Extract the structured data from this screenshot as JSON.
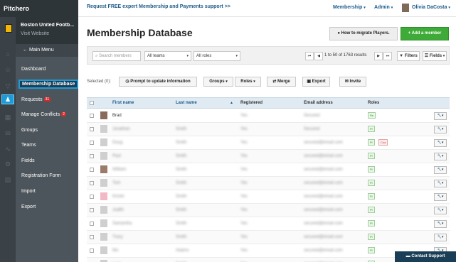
{
  "brand": "Pitchero",
  "club": {
    "name": "Boston United Footb...",
    "visit_label": "Visit Website"
  },
  "nav": {
    "main_menu": "Main Menu",
    "items": [
      {
        "label": "Dashboard"
      },
      {
        "label": "Membership Database",
        "selected": true
      },
      {
        "label": "Requests",
        "badge": "31"
      },
      {
        "label": "Manage Conflicts",
        "badge": "2"
      },
      {
        "label": "Groups"
      },
      {
        "label": "Teams"
      },
      {
        "label": "Fields"
      },
      {
        "label": "Registration Form"
      },
      {
        "label": "Import"
      },
      {
        "label": "Export"
      }
    ]
  },
  "topbar": {
    "promo": "Request FREE expert Membership and Payments support >>",
    "membership": "Membership",
    "admin": "Admin",
    "user": "Olivia DaCosta"
  },
  "page": {
    "title": "Membership Database",
    "migrate_button": "How to migrate Players.",
    "add_member_button": "+ Add a member"
  },
  "filters": {
    "search_placeholder": "Search members",
    "teams": "All teams",
    "roles": "All roles",
    "results": "1 to 50 of 1763 results",
    "filters_button": "Filters",
    "fields_button": "Fields"
  },
  "actions": {
    "selected": "Selected (0):",
    "prompt": "Prompt to update information",
    "groups": "Groups",
    "roles": "Roles",
    "merge": "Merge",
    "export": "Export",
    "invite": "Invite"
  },
  "table": {
    "columns": [
      "First name",
      "Last name",
      "Registered",
      "Email address",
      "Roles"
    ],
    "rows": [
      {
        "first": "Brad",
        "last": "",
        "registered": "Yes",
        "email": "Secured",
        "roles": [
          "Re"
        ],
        "thumb": "#8a6a5a"
      },
      {
        "first": "Jonathan",
        "last": "Smith",
        "registered": "Yes",
        "email": "Secured",
        "roles": [
          "Pl"
        ],
        "thumb": "#cfcfcf"
      },
      {
        "first": "Doug",
        "last": "Smith",
        "registered": "Yes",
        "email": "secured@email.com",
        "roles": [
          "Pl",
          "Coa"
        ],
        "thumb": "#cfcfcf"
      },
      {
        "first": "Paul",
        "last": "Smith",
        "registered": "Yes",
        "email": "secured@email.com",
        "roles": [
          "Pl"
        ],
        "thumb": "#cfcfcf"
      },
      {
        "first": "William",
        "last": "Smith",
        "registered": "Yes",
        "email": "secured@email.com",
        "roles": [
          "Pl"
        ],
        "thumb": "#9a7a68"
      },
      {
        "first": "Tom",
        "last": "Smith",
        "registered": "Yes",
        "email": "secured@email.com",
        "roles": [
          "Pl"
        ],
        "thumb": "#cfcfcf"
      },
      {
        "first": "Kristin",
        "last": "Smith",
        "registered": "Yes",
        "email": "secured@email.com",
        "roles": [
          "Pl"
        ],
        "thumb": "#f2b8c6"
      },
      {
        "first": "Judith",
        "last": "Smith",
        "registered": "Yes",
        "email": "secured@email.com",
        "roles": [
          "Pl"
        ],
        "thumb": "#cfcfcf"
      },
      {
        "first": "Samantha",
        "last": "Smith",
        "registered": "Yes",
        "email": "secured@email.com",
        "roles": [
          "Pl"
        ],
        "thumb": "#cfcfcf"
      },
      {
        "first": "Tracy",
        "last": "Smith",
        "registered": "Yes",
        "email": "secured@email.com",
        "roles": [
          "Pl"
        ],
        "thumb": "#cfcfcf"
      },
      {
        "first": "Mo",
        "last": "Adams",
        "registered": "Yes",
        "email": "secured@email.com",
        "roles": [
          "Pl"
        ],
        "thumb": "#cfcfcf"
      },
      {
        "first": "Lucy",
        "last": "Smith",
        "registered": "Yes",
        "email": "secured@email.com",
        "roles": [
          "Pl"
        ],
        "thumb": "#cfcfcf"
      }
    ]
  },
  "contact_support": "Contact Support",
  "colors": {
    "accent": "#1e9bd6",
    "add_button": "#3eab38",
    "nav_bg": "#4c555b",
    "header_row": "#dfeaf2"
  },
  "icons": [
    "home-icon",
    "user-icon",
    "members-icon",
    "calendar-icon",
    "chart-icon",
    "settings-icon",
    "search-icon",
    "chevron-down-icon",
    "wrench-icon"
  ]
}
